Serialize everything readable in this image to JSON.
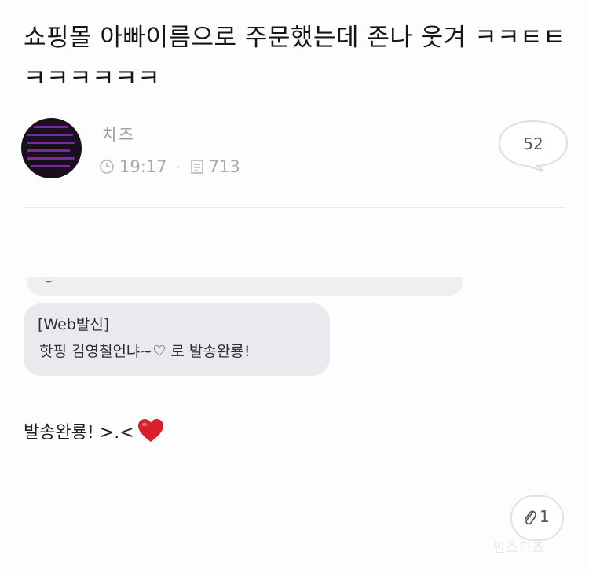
{
  "post": {
    "title": "쇼핑몰 아빠이름으로 주문했는데 존나 웃겨 ㅋㅋㅌㅌㅋㅋㅋㅋㅋㅋ",
    "author": "치즈",
    "time": "19:17",
    "views": "713",
    "comment_count": "52"
  },
  "message": {
    "sms_header": "[Web발신]",
    "sms_body": "핫핑 김영철언냐~♡  로 발송완룡!",
    "reply_text": "발송완룡! >.<"
  },
  "footer": {
    "attachment_count": "1",
    "watermark": "인스티즈"
  },
  "icons": {
    "avatar": "avatar-image",
    "clock": "clock-icon",
    "views": "views-icon",
    "comment": "speech-bubble-icon",
    "heart": "red-heart-emoji",
    "attachment": "paperclip-icon"
  },
  "colors": {
    "heart": "#d8202a",
    "avatar_accent": "#8a2fb0",
    "bubble": "#e9e9ee"
  }
}
